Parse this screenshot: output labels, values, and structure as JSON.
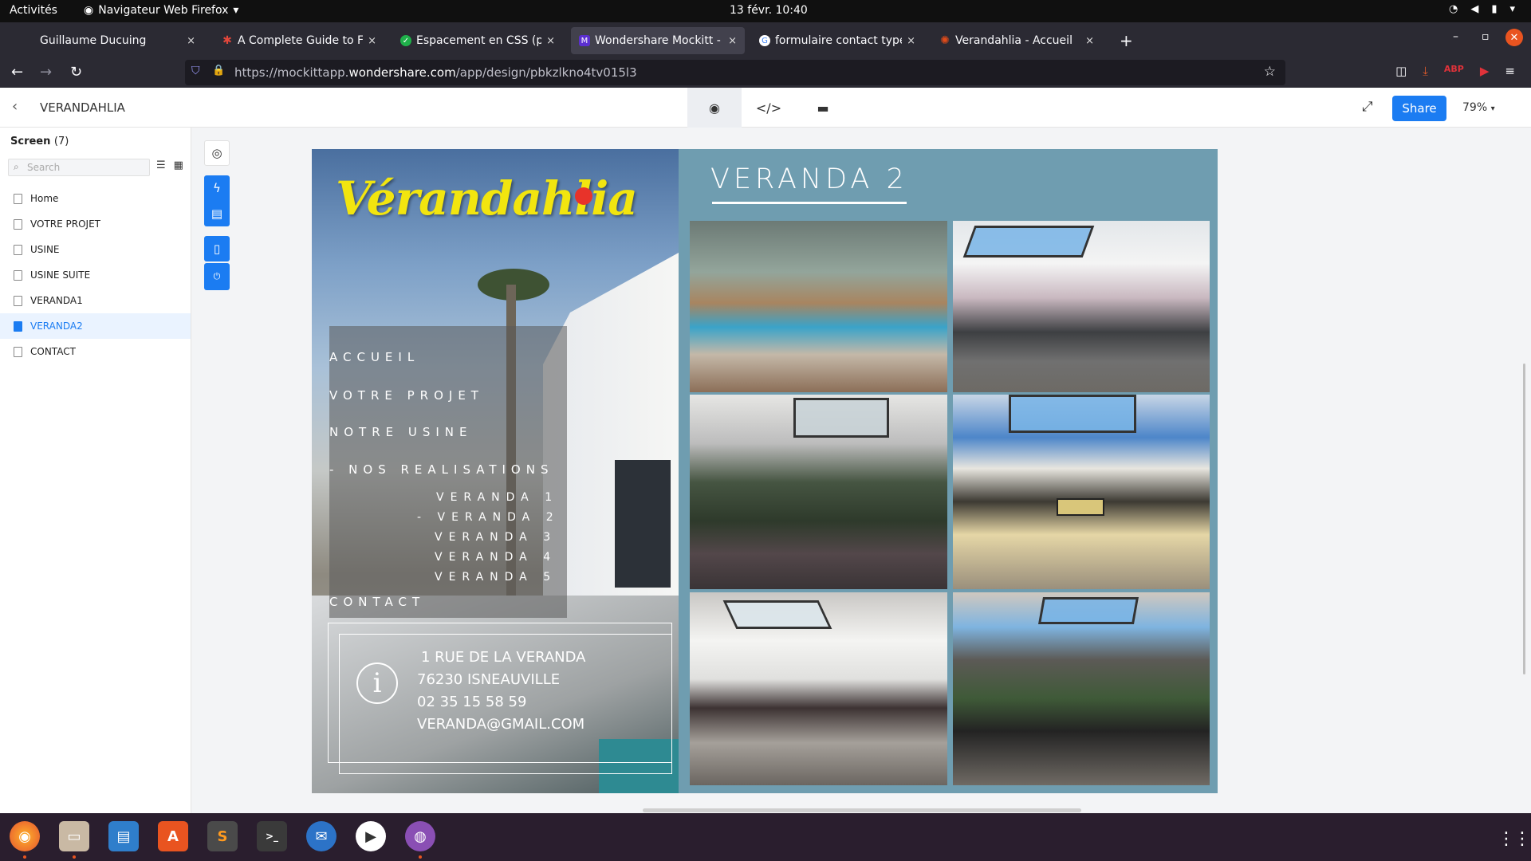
{
  "system": {
    "activities": "Activités",
    "app_name": "Navigateur Web Firefox",
    "clock": "13 févr.  10:40"
  },
  "tabs": [
    {
      "title": "Guillaume Ducuing",
      "close": "×"
    },
    {
      "title": "A Complete Guide to Fle",
      "close": "×"
    },
    {
      "title": "Espacement en CSS (pad",
      "close": "×"
    },
    {
      "title": "Wondershare Mockitt - V",
      "close": "×"
    },
    {
      "title": "formulaire contact type -",
      "close": "×"
    },
    {
      "title": "Verandahlia - Accueil",
      "close": "×"
    }
  ],
  "new_tab": "+",
  "url": {
    "prefix": "https://mockittapp.",
    "domain": "wondershare.com",
    "path": "/app/design/pbkzlkno4tv015l3"
  },
  "mockitt": {
    "project_name": "VERANDAHLIA",
    "share_label": "Share",
    "zoom": "79%",
    "screen_label": "Screen",
    "screen_count": "(7)",
    "search_placeholder": "Search",
    "screens": [
      {
        "label": "Home"
      },
      {
        "label": "VOTRE PROJET"
      },
      {
        "label": "USINE"
      },
      {
        "label": "USINE SUITE"
      },
      {
        "label": "VERANDA1"
      },
      {
        "label": "VERANDA2"
      },
      {
        "label": "CONTACT"
      }
    ],
    "active_screen": "VERANDA2"
  },
  "design": {
    "logo": "Vérandahlia",
    "menu": {
      "accueil": "ACCUEIL",
      "votre_projet": "VOTRE PROJET",
      "notre_usine": "NOTRE USINE",
      "nos_realisations": "- NOS REALISATIONS",
      "veranda1": "VERANDA 1",
      "veranda2": "- VERANDA 2",
      "veranda3": "VERANDA 3",
      "veranda4": "VERANDA 4",
      "veranda5": "VERANDA 5",
      "contact": "CONTACT"
    },
    "info": {
      "icon": "i",
      "address": "1 RUE DE LA VERANDA",
      "city": "76230 ISNEAUVILLE",
      "phone": "02 35 15 58 59",
      "email": "VERANDA@GMAIL.COM"
    },
    "page_title": "VERANDA 2"
  },
  "dock_glyphs": {
    "terminal": ">_"
  },
  "colors": {
    "accent": "#1b7cf2",
    "panel_blue": "#6f9db0",
    "logo_yellow": "#f2e50f"
  }
}
